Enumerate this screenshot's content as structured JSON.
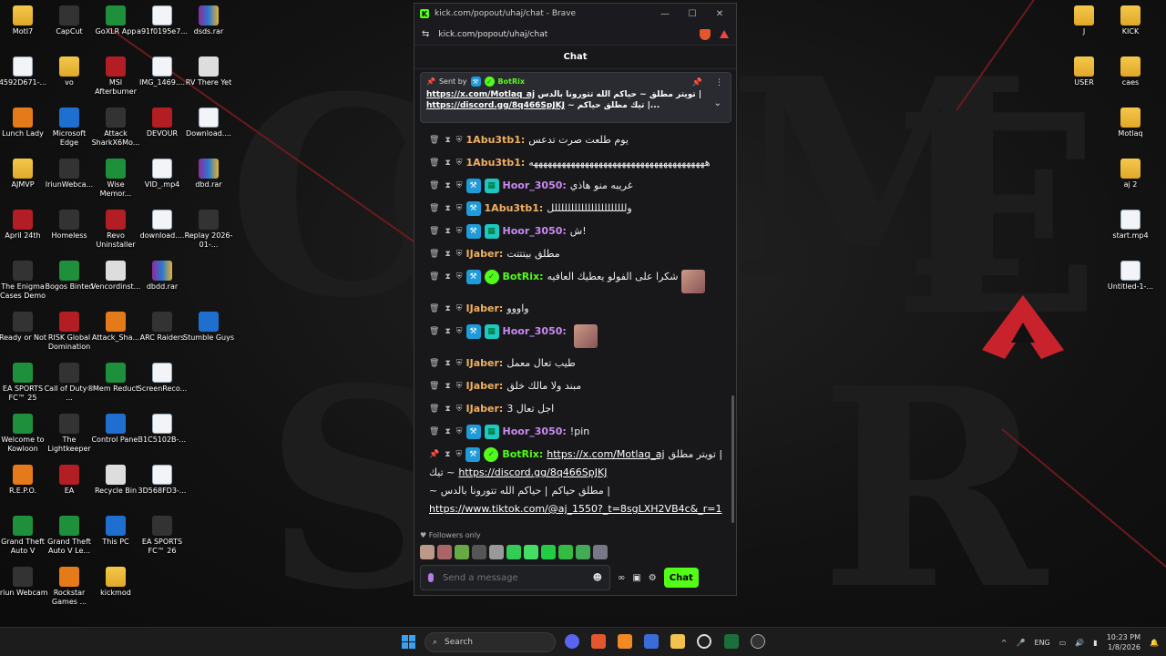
{
  "browser": {
    "title": "kick.com/popout/uhaj/chat - Brave",
    "url": "kick.com/popout/uhaj/chat",
    "minimize": "—",
    "maximize": "☐",
    "close": "✕"
  },
  "chat": {
    "header": "Chat",
    "pinned": {
      "sent_by": "Sent by",
      "author": "BotRix",
      "line1_text": "تويتر مطلق ~ حياكم الله تتورونا بالدس |",
      "line1_link": "https://x.com/Motlaq_aj",
      "line2_link": "https://discord.gg/8q466SpJKJ",
      "line2_text": "~ تيك مطلق حياكم |..."
    },
    "messages": [
      {
        "user": "1Abu3tb1:",
        "color": "#f0b060",
        "text": "يوم طلعت صرت تدعس",
        "badges": []
      },
      {
        "user": "1Abu3tb1:",
        "color": "#f0b060",
        "text": "ههههههههههههههههههههههههههههههههههههههه",
        "badges": []
      },
      {
        "user": "Hoor_3050:",
        "color": "#c98af0",
        "text": "غريبه منو هاذي",
        "badges": [
          "mod",
          "vip"
        ]
      },
      {
        "user": "1Abu3tb1:",
        "color": "#f0b060",
        "text": "وللللللللللللللللللللللل",
        "badges": [
          "mod"
        ]
      },
      {
        "user": "Hoor_3050:",
        "color": "#c98af0",
        "text": "ش!",
        "badges": [
          "mod",
          "vip"
        ]
      },
      {
        "user": "IJaber:",
        "color": "#f0b060",
        "text": "مطلق بيتتتت",
        "badges": []
      },
      {
        "user": "BotRix:",
        "color": "#53fc18",
        "text": "شكرا على الفولو يعطيك العافيه",
        "badges": [
          "mod",
          "verified"
        ],
        "emote": true
      },
      {
        "user": "IJaber:",
        "color": "#f0b060",
        "text": "واووو",
        "badges": []
      },
      {
        "user": "Hoor_3050:",
        "color": "#c98af0",
        "text": "",
        "badges": [
          "mod",
          "vip"
        ],
        "emote": true
      },
      {
        "user": "IJaber:",
        "color": "#f0b060",
        "text": "طيب تعال معمل",
        "badges": []
      },
      {
        "user": "IJaber:",
        "color": "#f0b060",
        "text": "مبند ولا مالك خلق",
        "badges": []
      },
      {
        "user": "IJaber:",
        "color": "#f0b060",
        "text": "اجل تعال 3",
        "badges": []
      },
      {
        "user": "Hoor_3050:",
        "color": "#c98af0",
        "text": "!pin",
        "badges": [
          "mod",
          "vip"
        ]
      }
    ],
    "last_message": {
      "user": "BotRix:",
      "link1": "https://x.com/Motlaq_aj",
      "text1": "تويتر مطلق |",
      "text2": "~ حياكم الله تتورونا بالدس |",
      "text2b": "تيك ~",
      "link2": "https://discord.gg/8q466SpJKJ",
      "text3": "مطلق حياكم |",
      "link3": "https://www.tiktok.com/@aj_1550?_t=8sgLXH2VB4c&_r=1"
    },
    "followers_only": "Followers only",
    "input_placeholder": "Send a message",
    "send_label": "Chat"
  },
  "desktop_left": [
    {
      "label": "MotI7",
      "kind": "folder"
    },
    {
      "label": "CapCut",
      "kind": "dark"
    },
    {
      "label": "GoXLR App",
      "kind": "green"
    },
    {
      "label": "a91f0195e7...",
      "kind": "file"
    },
    {
      "label": "dsds.rar",
      "kind": "rar"
    },
    {
      "label": "4592D671-...",
      "kind": "file"
    },
    {
      "label": "vo",
      "kind": "folder"
    },
    {
      "label": "MSI Afterburner",
      "kind": "red"
    },
    {
      "label": "IMG_1469....",
      "kind": "file"
    },
    {
      "label": "RV There Yet",
      "kind": "white"
    },
    {
      "label": "Lunch Lady",
      "kind": "orange"
    },
    {
      "label": "Microsoft Edge",
      "kind": "blue"
    },
    {
      "label": "Attack SharkX6Mo...",
      "kind": "dark"
    },
    {
      "label": "DEVOUR",
      "kind": "red"
    },
    {
      "label": "Download....",
      "kind": "file"
    },
    {
      "label": "AJMVP",
      "kind": "folder"
    },
    {
      "label": "IriunWebca...",
      "kind": "dark"
    },
    {
      "label": "Wise Memor...",
      "kind": "green"
    },
    {
      "label": "VID_.mp4",
      "kind": "file"
    },
    {
      "label": "dbd.rar",
      "kind": "rar"
    },
    {
      "label": "April 24th",
      "kind": "red"
    },
    {
      "label": "Homeless",
      "kind": "dark"
    },
    {
      "label": "Revo Uninstaller",
      "kind": "red"
    },
    {
      "label": "download....",
      "kind": "file"
    },
    {
      "label": "Replay 2026-01-...",
      "kind": "dark"
    },
    {
      "label": "The Enigma Cases Demo",
      "kind": "dark"
    },
    {
      "label": "Bogos Binted",
      "kind": "green"
    },
    {
      "label": "Vencordinst...",
      "kind": "white"
    },
    {
      "label": "dbdd.rar",
      "kind": "rar"
    },
    {
      "label": "",
      "kind": "none"
    },
    {
      "label": "Ready or Not",
      "kind": "dark"
    },
    {
      "label": "RISK Global Domination",
      "kind": "red"
    },
    {
      "label": "Attack_Sha...",
      "kind": "orange"
    },
    {
      "label": "ARC Raiders",
      "kind": "dark"
    },
    {
      "label": "Stumble Guys",
      "kind": "blue"
    },
    {
      "label": "EA SPORTS FC™ 25",
      "kind": "green"
    },
    {
      "label": "Call of Duty® ...",
      "kind": "dark"
    },
    {
      "label": "Mem Reduct",
      "kind": "green"
    },
    {
      "label": "ScreenReco...",
      "kind": "file"
    },
    {
      "label": "",
      "kind": "none"
    },
    {
      "label": "Welcome to Kowloon",
      "kind": "green"
    },
    {
      "label": "The Lightkeeper",
      "kind": "dark"
    },
    {
      "label": "Control Panel",
      "kind": "blue"
    },
    {
      "label": "31C5102B-...",
      "kind": "file"
    },
    {
      "label": "",
      "kind": "none"
    },
    {
      "label": "R.E.P.O.",
      "kind": "orange"
    },
    {
      "label": "EA",
      "kind": "red"
    },
    {
      "label": "Recycle Bin",
      "kind": "white"
    },
    {
      "label": "3D568FD3-...",
      "kind": "file"
    },
    {
      "label": "",
      "kind": "none"
    },
    {
      "label": "Grand Theft Auto V",
      "kind": "green"
    },
    {
      "label": "Grand Theft Auto V Le...",
      "kind": "green"
    },
    {
      "label": "This PC",
      "kind": "blue"
    },
    {
      "label": "EA SPORTS FC™ 26",
      "kind": "dark"
    },
    {
      "label": "",
      "kind": "none"
    },
    {
      "label": "Iriun Webcam",
      "kind": "dark"
    },
    {
      "label": "Rockstar Games ...",
      "kind": "orange"
    },
    {
      "label": "kickmod",
      "kind": "folder"
    },
    {
      "label": "",
      "kind": "none"
    },
    {
      "label": "",
      "kind": "none"
    }
  ],
  "desktop_right": [
    {
      "label": "J",
      "kind": "folder"
    },
    {
      "label": "KICK",
      "kind": "folder"
    },
    {
      "label": "USER",
      "kind": "folder"
    },
    {
      "label": "caes",
      "kind": "folder"
    },
    {
      "label": "",
      "kind": "none"
    },
    {
      "label": "Motlaq",
      "kind": "folder"
    },
    {
      "label": "",
      "kind": "none"
    },
    {
      "label": "aj 2",
      "kind": "folder"
    },
    {
      "label": "",
      "kind": "none"
    },
    {
      "label": "start.mp4",
      "kind": "file"
    },
    {
      "label": "",
      "kind": "none"
    },
    {
      "label": "Untitled-1-...",
      "kind": "file"
    }
  ],
  "taskbar": {
    "search": "Search",
    "lang": "ENG",
    "time": "10:23 PM",
    "date": "1/8/2026"
  }
}
